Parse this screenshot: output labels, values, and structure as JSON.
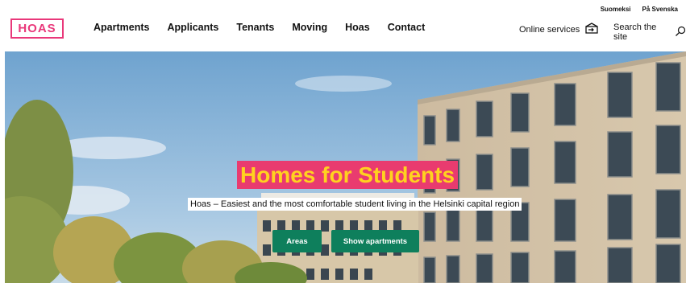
{
  "header": {
    "logo_text": "HOAS",
    "languages": [
      "Suomeksi",
      "På Svenska"
    ],
    "nav": [
      "Apartments",
      "Applicants",
      "Tenants",
      "Moving",
      "Hoas",
      "Contact"
    ],
    "online_services": "Online services",
    "search": "Search the site"
  },
  "hero": {
    "title": "Homes for Students",
    "subtitle": "Hoas – Easiest and the most comfortable student living in the Helsinki capital region",
    "buttons": {
      "areas": "Areas",
      "show_apartments": "Show apartments"
    }
  },
  "colors": {
    "brand_pink": "#e9387a",
    "title_yellow": "#ffd21f",
    "button_green": "#0e7f5c"
  },
  "icons": [
    "login-box-icon",
    "search-magnifier-icon"
  ]
}
